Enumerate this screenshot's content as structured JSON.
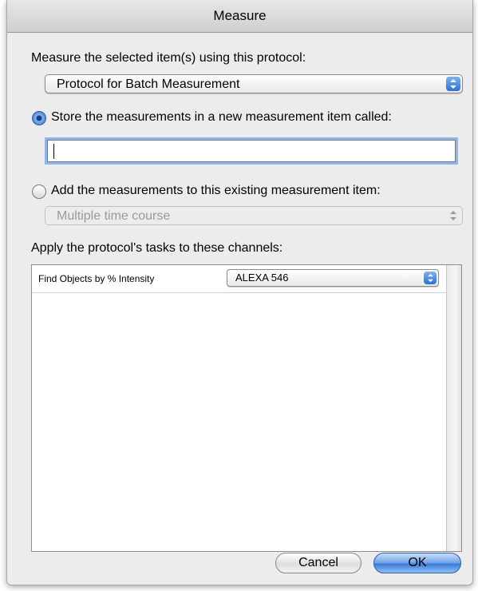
{
  "window": {
    "title": "Measure"
  },
  "protocol": {
    "label": "Measure the selected item(s) using this protocol:",
    "selected": "Protocol for Batch Measurement"
  },
  "store_option": {
    "label": "Store the measurements in a new measurement item called:",
    "selected": true,
    "name_value": ""
  },
  "add_option": {
    "label": "Add the measurements to this existing measurement item:",
    "selected": false,
    "existing_item": "Multiple time course",
    "enabled": false
  },
  "channels": {
    "label": "Apply the protocol's tasks to these channels:",
    "rows": [
      {
        "task": "Find Objects by % Intensity",
        "channel": "ALEXA 546"
      }
    ]
  },
  "buttons": {
    "cancel": "Cancel",
    "ok": "OK"
  },
  "colors": {
    "accent": "#3d7bd8",
    "focus_ring": "#8fb4ea"
  },
  "icons": {
    "popup": "updown-arrows-icon",
    "radio": "radio-button-icon"
  }
}
